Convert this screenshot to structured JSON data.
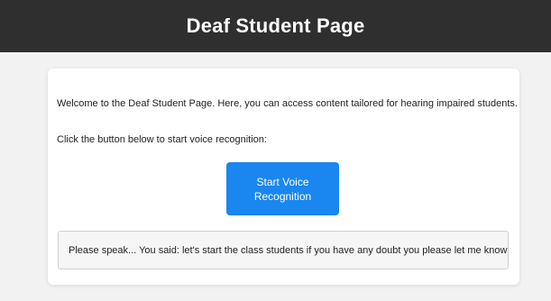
{
  "header": {
    "title": "Deaf Student Page"
  },
  "card": {
    "welcome_text": "Welcome to the Deaf Student Page. Here, you can access content tailored for hearing impaired students.",
    "instruction_text": "Click the button below to start voice recognition:",
    "button_label": "Start Voice Recognition",
    "output_text": "Please speak... You said: let's start the class students if you have any doubt you please let me know"
  },
  "colors": {
    "header_bg": "#2f2f2f",
    "page_bg": "#f2f2f2",
    "button_bg": "#1a86f0"
  }
}
